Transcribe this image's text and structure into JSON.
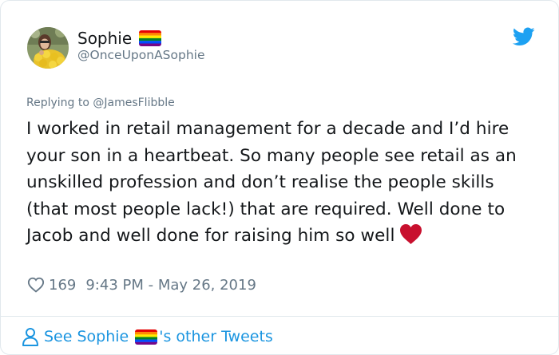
{
  "author": {
    "display_name": "Sophie",
    "handle": "@OnceUponASophie",
    "flag_icon": "rainbow-flag-icon"
  },
  "reply": {
    "replying_to": "Replying to @JamesFlibble"
  },
  "tweet": {
    "text": "I worked in retail management for a decade and I’d hire your son in a heartbeat. So many people see retail as an unskilled profession and don’t realise the people skills (that most people lack!) that are required. Well done to Jacob and well done for raising him so well",
    "emoji": "red-heart-icon"
  },
  "meta": {
    "likes": "169",
    "timestamp": "9:43 PM - May 26, 2019"
  },
  "footer": {
    "prefix": "See Sophie",
    "suffix": "'s other Tweets"
  },
  "colors": {
    "link_blue": "#1b95e0",
    "twitter_blue": "#1da1f2",
    "text": "#14171a",
    "secondary": "#657786",
    "border": "#e1e8ed",
    "heart_red": "#c8102e"
  }
}
